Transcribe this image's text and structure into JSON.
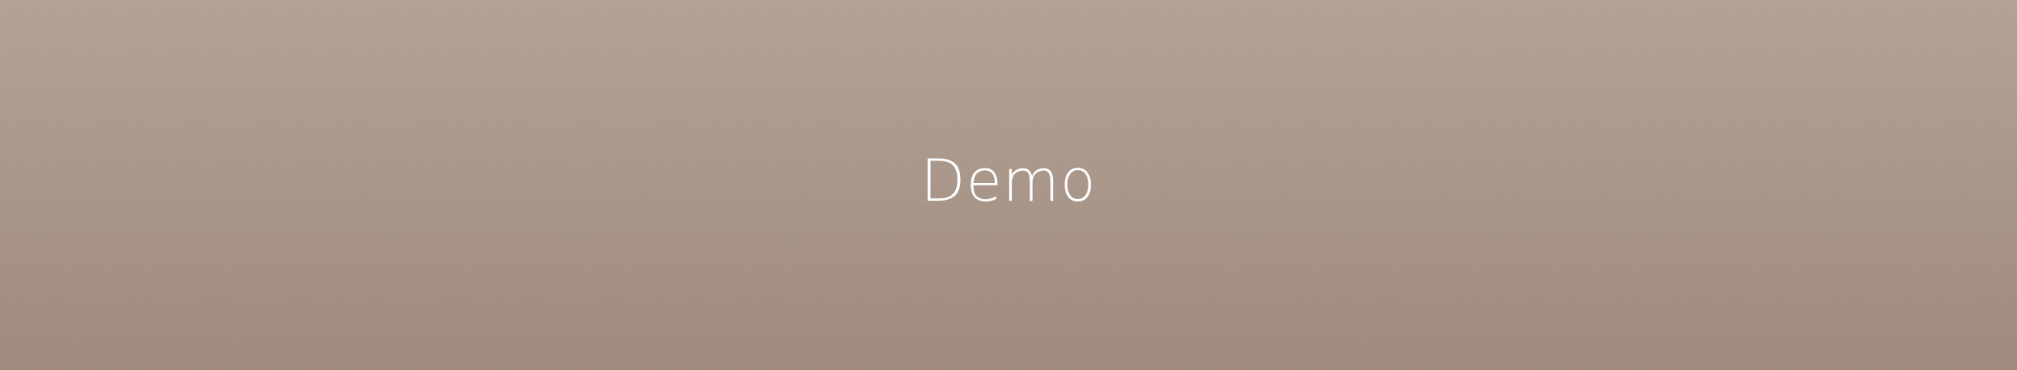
{
  "hero": {
    "title": "Demo"
  },
  "colors": {
    "background_top": "#b3a295",
    "background_bottom": "#9f8a7d",
    "text": "#ffffff"
  }
}
